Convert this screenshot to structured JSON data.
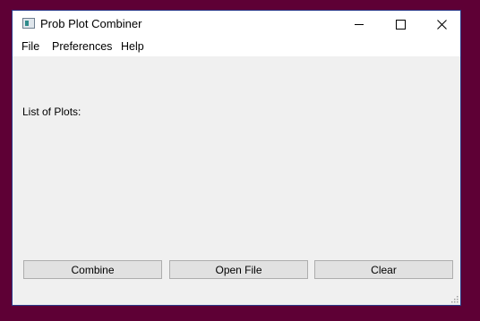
{
  "window": {
    "title": "Prob Plot Combiner"
  },
  "menu": {
    "items": [
      "File",
      "Preferences",
      "Help"
    ]
  },
  "main": {
    "list_label": "List of Plots:"
  },
  "buttons": {
    "combine": "Combine",
    "open_file": "Open File",
    "clear": "Clear"
  },
  "colors": {
    "desktop": "#5e0035",
    "window_bg": "#f0f0f0",
    "button_bg": "#e1e1e1"
  }
}
